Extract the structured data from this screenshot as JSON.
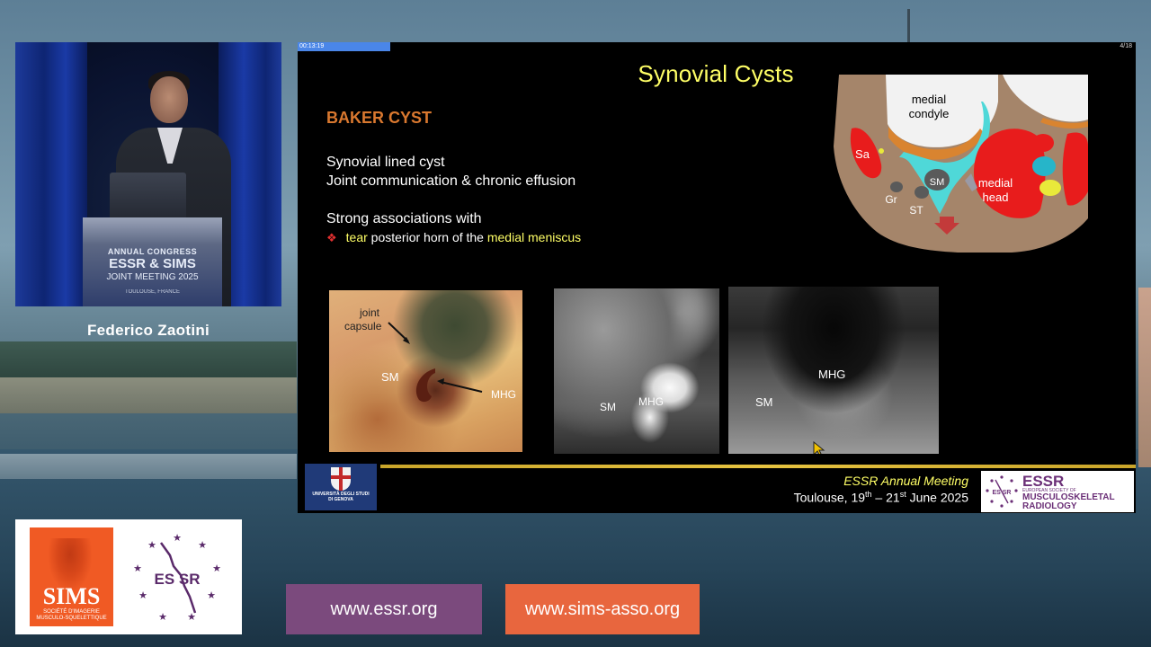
{
  "speaker": {
    "name": "Federico Zaotini",
    "podium": {
      "line1": "ANNUAL CONGRESS",
      "line2": "ESSR & SIMS",
      "line3": "JOINT MEETING 2025",
      "line4": "TOULOUSE, FRANCE"
    }
  },
  "slide": {
    "timer": "00:13:19",
    "page": "4/18",
    "title": "Synovial Cysts",
    "section": "BAKER CYST",
    "lines": [
      "Synovial lined cyst",
      "Joint communication & chronic effusion",
      "Strong associations with"
    ],
    "bullet": {
      "icon": "red-diamond-icon",
      "tear": "tear",
      "middle": " posterior horn of the ",
      "meniscus": "medial meniscus"
    },
    "diagram_labels": {
      "condyle_1": "medial",
      "condyle_2": "condyle",
      "sa": "Sa",
      "gr": "Gr",
      "sm": "SM",
      "st": "ST",
      "head_1": "medial",
      "head_2": "head"
    },
    "figures": {
      "cadaver": {
        "joint_1": "joint",
        "joint_2": "capsule",
        "sm": "SM",
        "mhg": "MHG"
      },
      "mri": {
        "sm": "SM",
        "mhg": "MHG"
      },
      "ultrasound": {
        "sm": "SM",
        "mhg": "MHG"
      }
    },
    "footer": {
      "university_1": "UNIVERSITÀ DEGLI STUDI",
      "university_2": "DI GENOVA",
      "meeting": "ESSR Annual Meeting",
      "date_prefix": "Toulouse, 19",
      "sup1": "th",
      "date_mid": " – 21",
      "sup2": "st",
      "date_suffix": " June 2025",
      "essr_big": "ESSR",
      "essr_small": "EUROPEAN SOCIETY OF",
      "essr_line1": "MUSCULOSKELETAL",
      "essr_line2": "RADIOLOGY"
    }
  },
  "sponsors": {
    "sims_word": "SIMS",
    "sims_sub_1": "SOCIÉTÉ D'IMAGERIE",
    "sims_sub_2": "MUSCULO-SQUELETTIQUE",
    "essr_ring_text": "ES SR"
  },
  "links": {
    "essr": "www.essr.org",
    "sims": "www.sims-asso.org"
  },
  "colors": {
    "title": "#ffff66",
    "section": "#d9782f",
    "essr_purple": "#7b4a7d",
    "sims_orange": "#e8663e"
  }
}
